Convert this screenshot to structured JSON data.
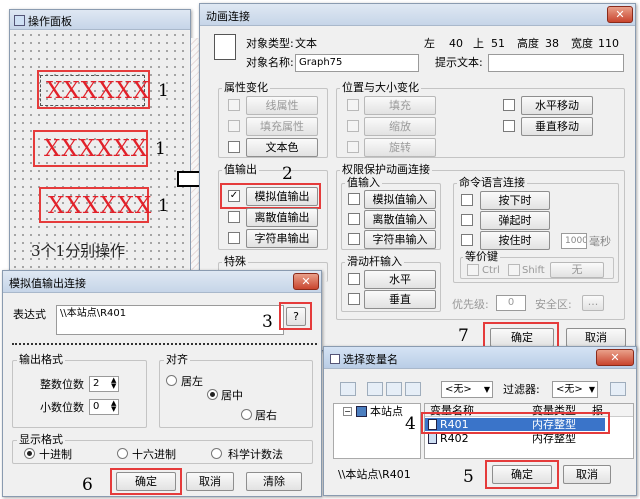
{
  "panel": {
    "title": "操作面板",
    "xtext": "XXXXXX",
    "nums": [
      "1",
      "1",
      "1"
    ],
    "note": "3个1分别操作"
  },
  "steps": {
    "s2": "2",
    "s3": "3",
    "s4": "4",
    "s5": "5",
    "s6": "6",
    "s7": "7"
  },
  "anim": {
    "title": "动画连接",
    "obj_type_label": "对象类型:",
    "obj_type": "文本",
    "left_label": "左",
    "left": "40",
    "top_label": "上",
    "top": "51",
    "height_label": "高度",
    "height": "38",
    "width_label": "宽度",
    "width": "110",
    "obj_name_label": "对象名称:",
    "obj_name": "Graph75",
    "hint_label": "提示文本:",
    "hint": "",
    "attr_group": "属性变化",
    "attr_items": [
      "线属性",
      "填充属性",
      "文本色"
    ],
    "pos_group": "位置与大小变化",
    "pos_items": [
      "填充",
      "缩放",
      "旋转"
    ],
    "move_items": [
      "水平移动",
      "垂直移动"
    ],
    "out_group": "值输出",
    "out_items": [
      "模拟值输出",
      "离散值输出",
      "字符串输出"
    ],
    "perm_group": "权限保护动画连接",
    "in_group": "值输入",
    "in_items": [
      "模拟值输入",
      "离散值输入",
      "字符串输入"
    ],
    "cmd_group": "命令语言连接",
    "cmd_items": [
      "按下时",
      "弹起时",
      "按住时"
    ],
    "ms_value": "1000",
    "ms_unit": "毫秒",
    "eq_group": "等价键",
    "ctrl": "Ctrl",
    "shift": "Shift",
    "none_key": "无",
    "special_group": "特殊",
    "slider_group": "滑动杆输入",
    "slider_items": [
      "水平",
      "垂直"
    ],
    "priority_label": "优先级:",
    "priority": "0",
    "security_label": "安全区:",
    "security_btn": "...",
    "ok": "确定",
    "cancel": "取消"
  },
  "analog": {
    "title": "模拟值输出连接",
    "expr_label": "表达式",
    "expr": "\\\\本站点\\R401",
    "q_btn": "?",
    "fmt_group": "输出格式",
    "int_label": "整数位数",
    "int_val": "2",
    "dec_label": "小数位数",
    "dec_val": "0",
    "align_group": "对齐",
    "align_left": "居左",
    "align_center": "居中",
    "align_right": "居右",
    "disp_group": "显示格式",
    "disp_dec": "十进制",
    "disp_hex": "十六进制",
    "disp_sci": "科学计数法",
    "ok": "确定",
    "cancel": "取消",
    "clear": "清除"
  },
  "select": {
    "title": "选择变量名",
    "combo1": "<无>",
    "filter_label": "过滤器:",
    "combo2": "<无>",
    "tree_root": "本站点",
    "col_name": "变量名称",
    "col_type": "变量类型",
    "col_extra": "报",
    "rows": [
      {
        "name": "R401",
        "type": "内存整型"
      },
      {
        "name": "R402",
        "type": "内存整型"
      }
    ],
    "path": "\\\\本站点\\R401",
    "ok": "确定",
    "cancel": "取消"
  }
}
